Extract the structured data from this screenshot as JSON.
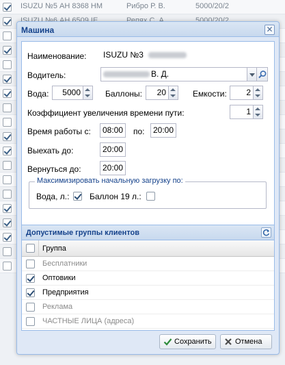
{
  "background_rows": [
    {
      "name": "ISUZU №5 АН 8368 НМ",
      "driver": "Рибро Р. В.",
      "stat": "5000/20/2",
      "checked": true
    },
    {
      "name": "ISUZU №6 АН 6509 IE",
      "driver": "Репях С. А.",
      "stat": "5000/20/2",
      "checked": true
    }
  ],
  "background_checks": [
    true,
    true,
    false,
    true,
    false,
    true,
    true,
    false,
    false,
    true,
    true,
    false,
    false,
    false,
    true,
    true,
    true,
    false,
    false
  ],
  "window": {
    "title": "Машина",
    "close_icon": "close-icon"
  },
  "form": {
    "name_label": "Наименование:",
    "name_value": "ISUZU №3",
    "driver_label": "Водитель:",
    "driver_value_suffix": "В. Д.",
    "water_label": "Вода:",
    "water_value": "5000",
    "balloons_label": "Баллоны:",
    "balloons_value": "20",
    "capacity_label": "Емкости:",
    "capacity_value": "2",
    "coef_label": "Коэффициент увеличения времени пути:",
    "coef_value": "1",
    "work_from_label": "Время работы с:",
    "work_from_value": "08:00",
    "work_to_label": "по:",
    "work_to_value": "20:00",
    "depart_label": "Выехать до:",
    "depart_value": "20:00",
    "return_label": "Вернуться до:",
    "return_value": "20:00",
    "maximize_legend": "Максимизировать начальную загрузку по:",
    "water_l_label": "Вода, л.:",
    "water_l_checked": true,
    "balloon19_label": "Баллон 19 л.:",
    "balloon19_checked": false
  },
  "groups": {
    "title": "Допустимые группы клиентов",
    "column_header": "Группа",
    "rows": [
      {
        "label": "Бесплатники",
        "checked": false,
        "dim": true
      },
      {
        "label": "Оптовики",
        "checked": true,
        "dim": false
      },
      {
        "label": "Предприятия",
        "checked": true,
        "dim": false
      },
      {
        "label": "Реклама",
        "checked": false,
        "dim": true
      },
      {
        "label": "ЧАСТНЫЕ ЛИЦА (адреса)",
        "checked": false,
        "dim": true
      }
    ]
  },
  "buttons": {
    "save": "Сохранить",
    "cancel": "Отмена"
  },
  "colors": {
    "header_text": "#15428b",
    "window_border": "#99bbe8",
    "save_check": "#2e8b3a",
    "cancel_x": "#4b4b4b"
  }
}
